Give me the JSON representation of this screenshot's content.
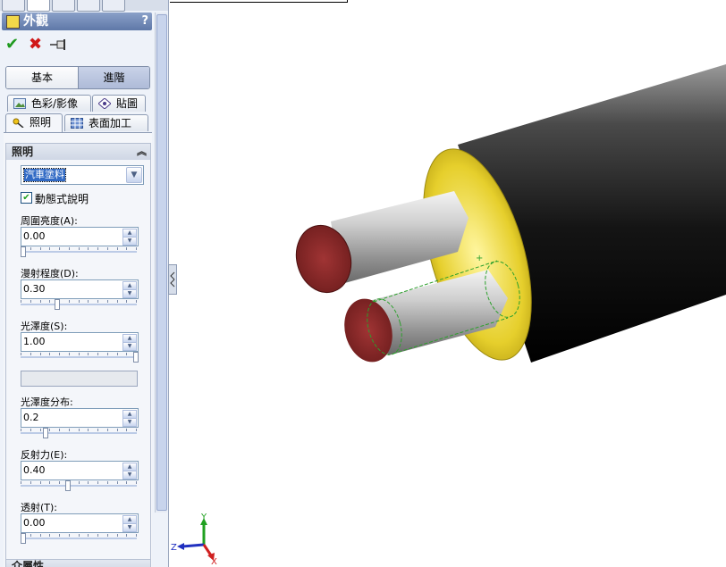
{
  "panel": {
    "title": "外觀",
    "help": "?",
    "actions": {
      "ok_icon": "checkmark-icon",
      "cancel_icon": "x-icon",
      "pin_icon": "pushpin-icon"
    },
    "mode_buttons": {
      "basic": "基本",
      "advanced": "進階"
    },
    "tabs": {
      "color": "色彩/影像",
      "decal": "貼圖",
      "lighting": "照明",
      "surface": "表面加工"
    },
    "lighting_group": {
      "title": "照明",
      "preset": "汽車塗料",
      "dynamic_help_label": "動態式說明",
      "dynamic_help_checked": true,
      "fields": [
        {
          "label": "周圍亮度(A):",
          "value": "0.00",
          "level": 0.0
        },
        {
          "label": "漫射程度(D):",
          "value": "0.30",
          "level": 0.3
        },
        {
          "label": "光澤度(S):",
          "value": "1.00",
          "level": 1.0
        },
        {
          "label": "光澤度分布:",
          "value": "0.2",
          "level": 0.2
        },
        {
          "label": "反射力(E):",
          "value": "0.40",
          "level": 0.4
        },
        {
          "label": "透射(T):",
          "value": "0.00",
          "level": 0.0
        }
      ]
    },
    "next_group": "介屬性"
  },
  "viewport": {
    "axis_labels": {
      "x": "X",
      "y": "Y",
      "z": "Z"
    },
    "colors": {
      "cable": "#1e1e1e",
      "insulation": "#e0c81e",
      "wire": "#b8b8b8",
      "wire_end": "#8a2a2a",
      "axis_x": "#d02020",
      "axis_y": "#20a020",
      "axis_z": "#2030c0"
    }
  }
}
